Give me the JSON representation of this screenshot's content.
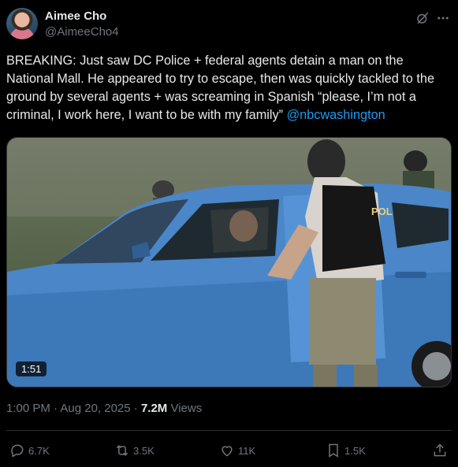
{
  "author": {
    "name": "Aimee Cho",
    "handle": "@AimeeCho4"
  },
  "tweet": {
    "text": "BREAKING: Just saw DC Police + federal agents detain a man on the National Mall. He appeared to try to escape, then was quickly tackled to the ground by several agents + was screaming in Spanish “please, I’m not a criminal, I work here, I want to be with my family” ",
    "mention": "@nbcwashington"
  },
  "media": {
    "duration": "1:51",
    "vest_text": "POL"
  },
  "meta": {
    "timestamp": "1:00 PM · Aug 20, 2025 · ",
    "views_count": "7.2M",
    "views_label": " Views"
  },
  "actions": {
    "replies": "6.7K",
    "reposts": "3.5K",
    "likes": "11K",
    "bookmarks": "1.5K"
  },
  "icons": {
    "reply": "reply-icon",
    "repost": "repost-icon",
    "like": "heart-icon",
    "bookmark": "bookmark-icon",
    "share": "share-icon",
    "grok": "grok-icon",
    "more": "more-icon"
  },
  "colors": {
    "background": "#000000",
    "text": "#e7e9ea",
    "muted": "#71767b",
    "link": "#1d9bf0"
  }
}
